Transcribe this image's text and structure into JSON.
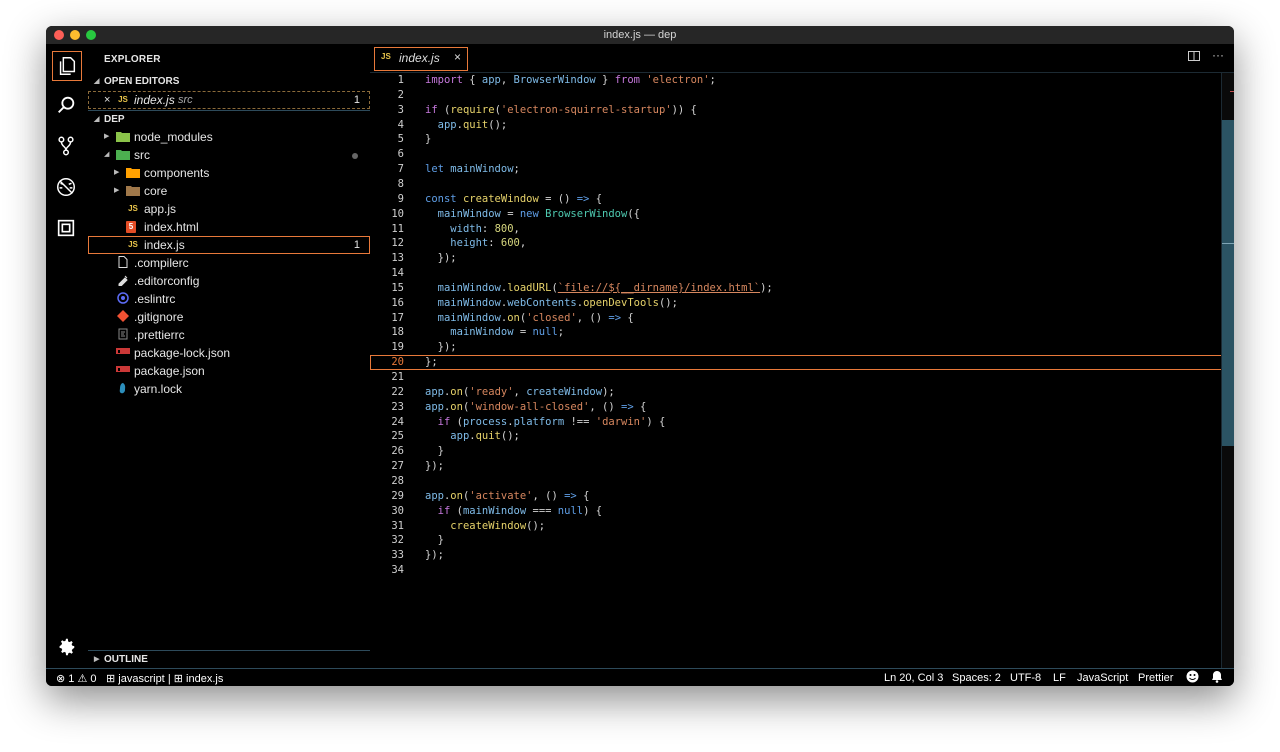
{
  "window": {
    "title": "index.js — dep"
  },
  "activity_bar": {
    "items": [
      {
        "icon": "files-icon",
        "active": true
      },
      {
        "icon": "search-icon",
        "active": false
      },
      {
        "icon": "source-control-icon",
        "active": false
      },
      {
        "icon": "debug-icon",
        "active": false
      },
      {
        "icon": "extensions-icon",
        "active": false
      }
    ],
    "settings_icon": "gear-icon"
  },
  "sidebar": {
    "title": "EXPLORER",
    "open_editors": {
      "label": "OPEN EDITORS",
      "items": [
        {
          "close": "×",
          "type": "JS",
          "name": "index.js",
          "folder": "src",
          "badge": "1"
        }
      ]
    },
    "folder": {
      "label": "DEP",
      "items": [
        {
          "name": "node_modules",
          "icon": "folder-node-icon",
          "kind": "folder",
          "depth": 0,
          "expanded": false
        },
        {
          "name": "src",
          "icon": "folder-src-icon",
          "kind": "folder",
          "depth": 0,
          "expanded": true,
          "modified": true
        },
        {
          "name": "components",
          "icon": "folder-components-icon",
          "kind": "folder",
          "depth": 1,
          "expanded": false
        },
        {
          "name": "core",
          "icon": "folder-core-icon",
          "kind": "folder",
          "depth": 1,
          "expanded": false
        },
        {
          "name": "app.js",
          "icon": "js-file-icon",
          "kind": "file",
          "depth": 1,
          "badge_text": "JS"
        },
        {
          "name": "index.html",
          "icon": "html-file-icon",
          "kind": "file",
          "depth": 1,
          "badge_text": "5"
        },
        {
          "name": "index.js",
          "icon": "js-file-icon",
          "kind": "file",
          "depth": 1,
          "badge_text": "JS",
          "selected": true,
          "count": "1"
        },
        {
          "name": ".compilerc",
          "icon": "file-icon",
          "kind": "file",
          "depth": 0
        },
        {
          "name": ".editorconfig",
          "icon": "editorconfig-icon",
          "kind": "file",
          "depth": 0
        },
        {
          "name": ".eslintrc",
          "icon": "eslint-icon",
          "kind": "file",
          "depth": 0
        },
        {
          "name": ".gitignore",
          "icon": "git-icon",
          "kind": "file",
          "depth": 0
        },
        {
          "name": ".prettierrc",
          "icon": "prettier-icon",
          "kind": "file",
          "depth": 0
        },
        {
          "name": "package-lock.json",
          "icon": "npm-icon",
          "kind": "file",
          "depth": 0
        },
        {
          "name": "package.json",
          "icon": "npm-icon",
          "kind": "file",
          "depth": 0
        },
        {
          "name": "yarn.lock",
          "icon": "yarn-icon",
          "kind": "file",
          "depth": 0
        }
      ]
    },
    "outline": {
      "label": "OUTLINE"
    }
  },
  "editor": {
    "tab": {
      "type": "JS",
      "name": "index.js",
      "close": "×"
    },
    "actions": {
      "split": "split-editor-icon",
      "more": "···"
    },
    "current_line": 20,
    "lines": [
      [
        [
          "kw",
          "import"
        ],
        [
          "p",
          " { "
        ],
        [
          "var",
          "app"
        ],
        [
          "p",
          ", "
        ],
        [
          "var",
          "BrowserWindow"
        ],
        [
          "p",
          " } "
        ],
        [
          "kw",
          "from"
        ],
        [
          "p",
          " "
        ],
        [
          "str",
          "'electron'"
        ],
        [
          "p",
          ";"
        ]
      ],
      [],
      [
        [
          "kw",
          "if"
        ],
        [
          "p",
          " ("
        ],
        [
          "fn",
          "require"
        ],
        [
          "p",
          "("
        ],
        [
          "str",
          "'electron-squirrel-startup'"
        ],
        [
          "p",
          ")) {"
        ]
      ],
      [
        [
          "p",
          "  "
        ],
        [
          "var",
          "app"
        ],
        [
          "p",
          "."
        ],
        [
          "fn",
          "quit"
        ],
        [
          "p",
          "();"
        ]
      ],
      [
        [
          "p",
          "}"
        ]
      ],
      [],
      [
        [
          "kwb",
          "let"
        ],
        [
          "p",
          " "
        ],
        [
          "var",
          "mainWindow"
        ],
        [
          "p",
          ";"
        ]
      ],
      [],
      [
        [
          "kwb",
          "const"
        ],
        [
          "p",
          " "
        ],
        [
          "fn",
          "createWindow"
        ],
        [
          "p",
          " = () "
        ],
        [
          "kwb",
          "=>"
        ],
        [
          "p",
          " {"
        ]
      ],
      [
        [
          "p",
          "  "
        ],
        [
          "var",
          "mainWindow"
        ],
        [
          "p",
          " = "
        ],
        [
          "kwb",
          "new"
        ],
        [
          "p",
          " "
        ],
        [
          "cls",
          "BrowserWindow"
        ],
        [
          "p",
          "({"
        ]
      ],
      [
        [
          "p",
          "    "
        ],
        [
          "prop",
          "width"
        ],
        [
          "p",
          ": "
        ],
        [
          "num",
          "800"
        ],
        [
          "p",
          ","
        ]
      ],
      [
        [
          "p",
          "    "
        ],
        [
          "prop",
          "height"
        ],
        [
          "p",
          ": "
        ],
        [
          "num",
          "600"
        ],
        [
          "p",
          ","
        ]
      ],
      [
        [
          "p",
          "  });"
        ]
      ],
      [],
      [
        [
          "p",
          "  "
        ],
        [
          "var",
          "mainWindow"
        ],
        [
          "p",
          "."
        ],
        [
          "fn",
          "loadURL"
        ],
        [
          "p",
          "("
        ],
        [
          "tpl",
          "`file://${__dirname}/index.html`"
        ],
        [
          "p",
          ");"
        ]
      ],
      [
        [
          "p",
          "  "
        ],
        [
          "var",
          "mainWindow"
        ],
        [
          "p",
          "."
        ],
        [
          "prop",
          "webContents"
        ],
        [
          "p",
          "."
        ],
        [
          "fn",
          "openDevTools"
        ],
        [
          "p",
          "();"
        ]
      ],
      [
        [
          "p",
          "  "
        ],
        [
          "var",
          "mainWindow"
        ],
        [
          "p",
          "."
        ],
        [
          "fn",
          "on"
        ],
        [
          "p",
          "("
        ],
        [
          "str",
          "'closed'"
        ],
        [
          "p",
          ", () "
        ],
        [
          "kwb",
          "=>"
        ],
        [
          "p",
          " {"
        ]
      ],
      [
        [
          "p",
          "    "
        ],
        [
          "var",
          "mainWindow"
        ],
        [
          "p",
          " = "
        ],
        [
          "kwb",
          "null"
        ],
        [
          "p",
          ";"
        ]
      ],
      [
        [
          "p",
          "  });"
        ]
      ],
      [
        [
          "p",
          "};"
        ]
      ],
      [],
      [
        [
          "var",
          "app"
        ],
        [
          "p",
          "."
        ],
        [
          "fn",
          "on"
        ],
        [
          "p",
          "("
        ],
        [
          "str",
          "'ready'"
        ],
        [
          "p",
          ", "
        ],
        [
          "var",
          "createWindow"
        ],
        [
          "p",
          ");"
        ]
      ],
      [
        [
          "var",
          "app"
        ],
        [
          "p",
          "."
        ],
        [
          "fn",
          "on"
        ],
        [
          "p",
          "("
        ],
        [
          "str",
          "'window-all-closed'"
        ],
        [
          "p",
          ", () "
        ],
        [
          "kwb",
          "=>"
        ],
        [
          "p",
          " {"
        ]
      ],
      [
        [
          "p",
          "  "
        ],
        [
          "kw",
          "if"
        ],
        [
          "p",
          " ("
        ],
        [
          "var",
          "process"
        ],
        [
          "p",
          "."
        ],
        [
          "prop",
          "platform"
        ],
        [
          "p",
          " !== "
        ],
        [
          "str",
          "'darwin'"
        ],
        [
          "p",
          ") {"
        ]
      ],
      [
        [
          "p",
          "    "
        ],
        [
          "var",
          "app"
        ],
        [
          "p",
          "."
        ],
        [
          "fn",
          "quit"
        ],
        [
          "p",
          "();"
        ]
      ],
      [
        [
          "p",
          "  }"
        ]
      ],
      [
        [
          "p",
          "});"
        ]
      ],
      [],
      [
        [
          "var",
          "app"
        ],
        [
          "p",
          "."
        ],
        [
          "fn",
          "on"
        ],
        [
          "p",
          "("
        ],
        [
          "str",
          "'activate'"
        ],
        [
          "p",
          ", () "
        ],
        [
          "kwb",
          "=>"
        ],
        [
          "p",
          " {"
        ]
      ],
      [
        [
          "p",
          "  "
        ],
        [
          "kw",
          "if"
        ],
        [
          "p",
          " ("
        ],
        [
          "var",
          "mainWindow"
        ],
        [
          "p",
          " === "
        ],
        [
          "kwb",
          "null"
        ],
        [
          "p",
          ") {"
        ]
      ],
      [
        [
          "p",
          "    "
        ],
        [
          "fn",
          "createWindow"
        ],
        [
          "p",
          "();"
        ]
      ],
      [
        [
          "p",
          "  }"
        ]
      ],
      [
        [
          "p",
          "});"
        ]
      ],
      []
    ]
  },
  "status_bar": {
    "errors": "1",
    "warnings": "0",
    "language_left": "javascript",
    "separator": "|",
    "file": "index.js",
    "position": "Ln 20, Col 3",
    "spaces": "Spaces: 2",
    "encoding": "UTF-8",
    "eol": "LF",
    "language": "JavaScript",
    "formatter": "Prettier",
    "feedback_icon": "smiley-icon",
    "bell_icon": "bell-icon"
  },
  "colors": {
    "accent": "#e8793a",
    "border": "#2d4a5a",
    "scroll_thumb": "#2b5363"
  }
}
